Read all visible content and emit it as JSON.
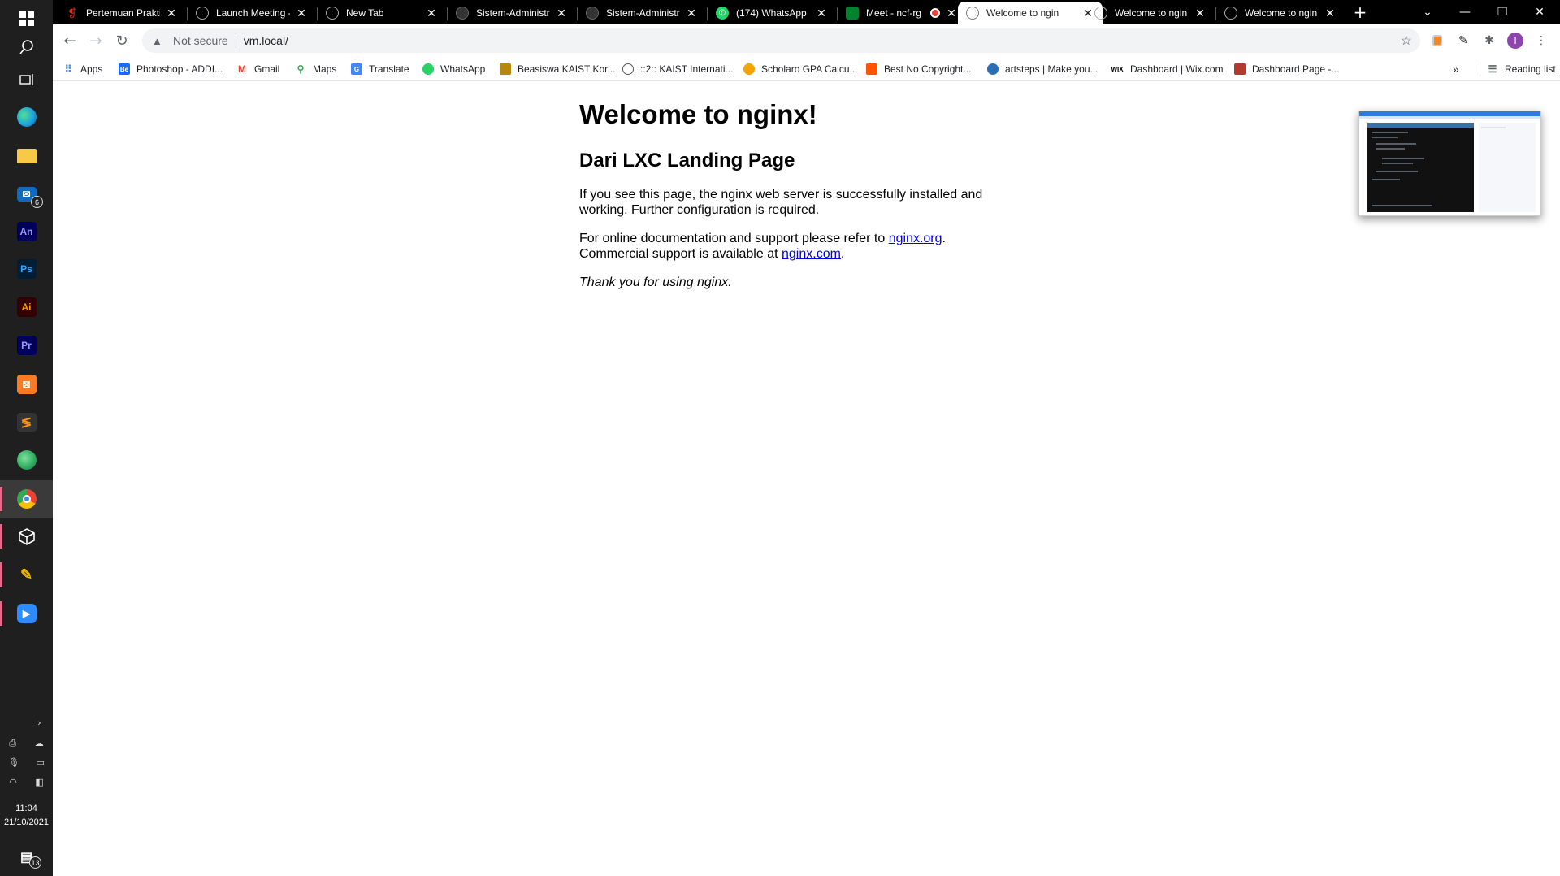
{
  "taskbar": {
    "apps": [
      {
        "name": "windows-start",
        "label": "",
        "color": "#ffffff"
      },
      {
        "name": "search",
        "label": "",
        "color": "#ffffff"
      },
      {
        "name": "task-view",
        "label": "",
        "color": "#ffffff"
      },
      {
        "name": "edge",
        "label": "",
        "color": "#1fa3e0"
      },
      {
        "name": "file-explorer",
        "label": "",
        "color": "#f7c948"
      },
      {
        "name": "mail",
        "label": "",
        "color": "#0f6cbd",
        "badge": "6"
      },
      {
        "name": "animate",
        "label": "An",
        "color": "#00005b"
      },
      {
        "name": "photoshop",
        "label": "Ps",
        "color": "#001e36"
      },
      {
        "name": "illustrator",
        "label": "Ai",
        "color": "#330000"
      },
      {
        "name": "premiere",
        "label": "Pr",
        "color": "#00005b"
      },
      {
        "name": "xampp",
        "label": "",
        "color": "#fb7a24"
      },
      {
        "name": "sublime",
        "label": "",
        "color": "#ff9800"
      },
      {
        "name": "globe-app",
        "label": "",
        "color": "#2eaa5c"
      },
      {
        "name": "chrome",
        "label": "",
        "color": "#ea4335"
      },
      {
        "name": "virtualbox",
        "label": "",
        "color": "#ffffff"
      },
      {
        "name": "paint-tool",
        "label": "",
        "color": "#f2b705"
      },
      {
        "name": "zoom",
        "label": "",
        "color": "#2d8cff"
      }
    ],
    "time": "11:04",
    "date": "21/10/2021",
    "notifications": "13"
  },
  "tabs": [
    {
      "title": "Pertemuan Praktik",
      "icon": "presentation-icon",
      "color": "#d93025"
    },
    {
      "title": "Launch Meeting -",
      "icon": "globe-icon",
      "color": "#888888"
    },
    {
      "title": "New Tab",
      "icon": "globe-icon",
      "color": "#888888"
    },
    {
      "title": "Sistem-Administr",
      "icon": "github-icon",
      "color": "#333333"
    },
    {
      "title": "Sistem-Administr",
      "icon": "github-icon",
      "color": "#333333"
    },
    {
      "title": "(174) WhatsApp",
      "icon": "whatsapp-icon",
      "color": "#25d366"
    },
    {
      "title": "Meet - ncf-rg",
      "icon": "meet-icon",
      "color": "#00832d"
    },
    {
      "title": "Welcome to ngin",
      "icon": "globe-icon",
      "color": "#888888",
      "active": true
    },
    {
      "title": "Welcome to ngin",
      "icon": "globe-icon",
      "color": "#888888"
    },
    {
      "title": "Welcome to ngin",
      "icon": "globe-icon",
      "color": "#888888"
    }
  ],
  "address_bar": {
    "security": "Not secure",
    "url": "vm.local/"
  },
  "bookmarks": [
    {
      "label": "Apps",
      "icon": "apps-grid-icon",
      "color": "#4285f4"
    },
    {
      "label": "Photoshop - ADDI...",
      "icon": "behance-icon",
      "color": "#1769ff"
    },
    {
      "label": "Gmail",
      "icon": "gmail-icon",
      "color": "#ea4335"
    },
    {
      "label": "Maps",
      "icon": "maps-icon",
      "color": "#34a853"
    },
    {
      "label": "Translate",
      "icon": "translate-icon",
      "color": "#4285f4"
    },
    {
      "label": "WhatsApp",
      "icon": "whatsapp-icon",
      "color": "#25d366"
    },
    {
      "label": "Beasiswa KAIST Kor...",
      "icon": "kaist-icon",
      "color": "#b8860b"
    },
    {
      "label": "::2:: KAIST Internati...",
      "icon": "globe-icon",
      "color": "#555555"
    },
    {
      "label": "Scholaro GPA Calcu...",
      "icon": "scholaro-icon",
      "color": "#f4a300"
    },
    {
      "label": "Best No Copyright...",
      "icon": "soundcloud-icon",
      "color": "#ff5500"
    },
    {
      "label": "artsteps | Make you...",
      "icon": "artsteps-icon",
      "color": "#2a6fb5"
    },
    {
      "label": "Dashboard | Wix.com",
      "icon": "wix-icon",
      "color": "#000000"
    },
    {
      "label": "Dashboard Page -...",
      "icon": "dashboard-icon",
      "color": "#b03a2e"
    }
  ],
  "bookmarks_overflow": "»",
  "reading_list": "Reading list",
  "page": {
    "heading": "Welcome to nginx!",
    "subheading": "Dari LXC Landing Page",
    "para1": "If you see this page, the nginx web server is successfully installed and working. Further configuration is required.",
    "para2_prefix": "For online documentation and support please refer to ",
    "link1": "nginx.org",
    "para2_mid": ".",
    "para2_line2": "Commercial support is available at ",
    "link2": "nginx.com",
    "para2_end": ".",
    "thanks": "Thank you for using nginx."
  }
}
